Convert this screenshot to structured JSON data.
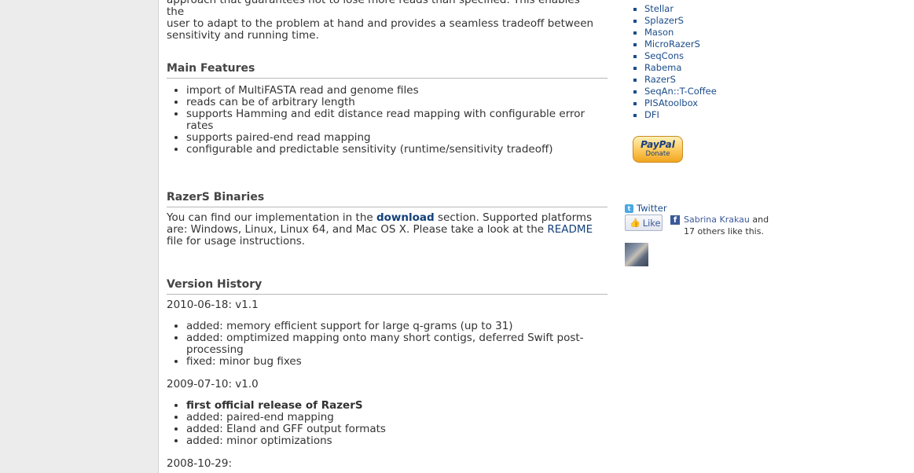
{
  "intro": {
    "line1": "approach that guarantees not to lose more reads than specified. This enables the",
    "line2": "user to adapt to the problem at hand and provides a seamless tradeoff between",
    "line3": "sensitivity and running time."
  },
  "main_features": {
    "heading": "Main Features",
    "items": [
      "import of MultiFASTA read and genome files",
      "reads can be of arbitrary length",
      "supports Hamming and edit distance read mapping with configurable error rates",
      "supports paired-end read mapping",
      "configurable and predictable sensitivity (runtime/sensitivity tradeoff)"
    ]
  },
  "binaries": {
    "heading": "RazerS Binaries",
    "text_before": "You can find our implementation in the ",
    "download_link": "download",
    "text_middle": " section. Supported platforms are: Windows, Linux, Linux 64, and Mac OS X. Please take a look at the ",
    "readme_link": "README",
    "text_after": " file for usage instructions."
  },
  "history": {
    "heading": "Version History",
    "v11": {
      "label": "2010-06-18: v1.1",
      "items": [
        "added: memory efficient support for large q-grams (up to 31)",
        "added: omptimized mapping onto many short contigs, deferred Swift post-processing",
        "fixed: minor bug fixes"
      ]
    },
    "v10": {
      "label": "2009-07-10: v1.0",
      "bold_item": "first official release of RazerS",
      "items": [
        "added: paired-end mapping",
        "added: Eland and GFF output formats",
        "added: minor optimizations"
      ]
    },
    "v0": {
      "label": "2008-10-29:"
    }
  },
  "sidebar": {
    "links": [
      "Stellar",
      "SplazerS",
      "Mason",
      "MicroRazerS",
      "SeqCons",
      "Rabema",
      "RazerS",
      "SeqAn::T-Coffee",
      "PISAtoolbox",
      "DFI"
    ],
    "paypal": {
      "brand": "PayPal",
      "action": "Donate"
    },
    "twitter": "Twitter",
    "like_button": "Like",
    "fb_name": "Sabrina Krakau",
    "fb_and": " and",
    "fb_others": "17 others like this."
  },
  "colors": {
    "link": "#1b4c8a",
    "background": "#ececec",
    "facebook": "#3b5998"
  }
}
